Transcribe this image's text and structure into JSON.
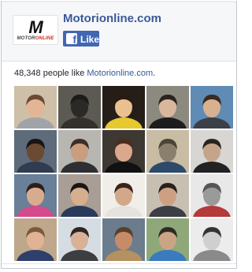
{
  "page": {
    "name": "Motorionline.com",
    "logo_text": "M",
    "logo_word_main": "MOTOR",
    "logo_word_accent": "ONLINE",
    "like_button": "Like",
    "fb_icon": "f"
  },
  "likes": {
    "count": "48,348",
    "text_before": " people like ",
    "link": "Motorionline.com",
    "text_after": "."
  },
  "icons": {
    "facebook": "facebook-f-icon"
  },
  "colors": {
    "brand_blue": "#3b5998",
    "button_blue": "#4267b2",
    "link_blue": "#365899",
    "logo_accent": "#d0231d"
  },
  "faces": [
    {
      "bg": "#cdbfa8",
      "skin": "#e4b594",
      "hair": "#6b4a32",
      "shirt": "#a0a4a8"
    },
    {
      "bg": "#5c5a52",
      "skin": "#2a2926",
      "hair": "#1c1b19",
      "shirt": "#34312d"
    },
    {
      "bg": "#241d18",
      "skin": "#e9c08f",
      "hair": "#2a1a12",
      "shirt": "#e6c92e"
    },
    {
      "bg": "#8c8a7e",
      "skin": "#d9b79c",
      "hair": "#2b2320",
      "shirt": "#1d1d1f"
    },
    {
      "bg": "#5f8bb5",
      "skin": "#d8b191",
      "hair": "#3a2a20",
      "shirt": "#3a3f48"
    },
    {
      "bg": "#5d6b7a",
      "skin": "#6a4a33",
      "hair": "#1a1412",
      "shirt": "#2f3c52"
    },
    {
      "bg": "#b7b6b1",
      "skin": "#c89e7e",
      "hair": "#3b2f28",
      "shirt": "#2f2f31"
    },
    {
      "bg": "#3e3833",
      "skin": "#dba88e",
      "hair": "#4a2d1f",
      "shirt": "#111111"
    },
    {
      "bg": "#c9bca5",
      "skin": "#8a7f6c",
      "hair": "#4a4538",
      "shirt": "#2d4a6a"
    },
    {
      "bg": "#d8d6d2",
      "skin": "#c4a48b",
      "hair": "#2a2420",
      "shirt": "#202224"
    },
    {
      "bg": "#6a7f98",
      "skin": "#d9ab8e",
      "hair": "#2c1f19",
      "shirt": "#d44a8a"
    },
    {
      "bg": "#a89e96",
      "skin": "#d7ae8e",
      "hair": "#1c1614",
      "shirt": "#2a3a5a"
    },
    {
      "bg": "#f1eee9",
      "skin": "#d3a78a",
      "hair": "#3a2418",
      "shirt": "#e6e3df"
    },
    {
      "bg": "#c8bfb3",
      "skin": "#cda083",
      "hair": "#2a201c",
      "shirt": "#3b3f45"
    },
    {
      "bg": "#e8e8e8",
      "skin": "#9a9a9a",
      "hair": "#555555",
      "shirt": "#b33b3b"
    },
    {
      "bg": "#bfa78b",
      "skin": "#e0b394",
      "hair": "#7a5a3c",
      "shirt": "#2f3f6b"
    },
    {
      "bg": "#d5dde3",
      "skin": "#d8b196",
      "hair": "#2e2621",
      "shirt": "#3c3e42"
    },
    {
      "bg": "#6b7d8d",
      "skin": "#c78b6a",
      "hair": "#5a3f2b",
      "shirt": "#b59060"
    },
    {
      "bg": "#8fa87a",
      "skin": "#c9a586",
      "hair": "#2e2a26",
      "shirt": "#3a7bbd"
    },
    {
      "bg": "#ececec",
      "skin": "#cfcfcf",
      "hair": "#333333",
      "shirt": "#8a8a8a"
    }
  ]
}
